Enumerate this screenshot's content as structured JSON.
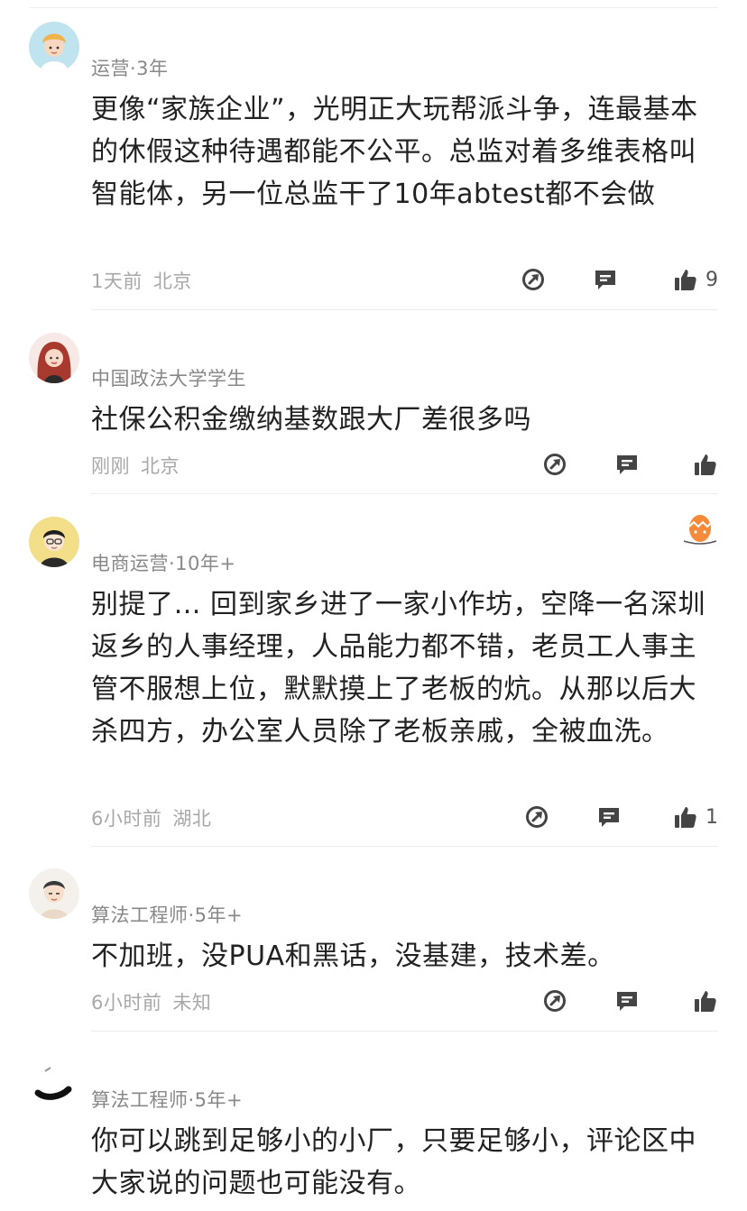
{
  "comments": [
    {
      "meta": "运营·3年",
      "text": "更像“家族企业”，光明正大玩帮派斗争，连最基本的休假这种待遇都能不公平。总监对着多维表格叫智能体，另一位总监干了10年abtest都不会做",
      "time": "1天前",
      "location": "北京",
      "likes": "9"
    },
    {
      "meta": "中国政法大学学生",
      "text": "社保公积金缴纳基数跟大厂差很多吗",
      "time": "刚刚",
      "location": "北京",
      "likes": ""
    },
    {
      "meta": "电商运营·10年+",
      "text": "别提了… 回到家乡进了一家小作坊，空降一名深圳返乡的人事经理，人品能力都不错，老员工人事主管不服想上位，默默摸上了老板的炕。从那以后大杀四方，办公室人员除了老板亲戚，全被血洗。",
      "time": "6小时前",
      "location": "湖北",
      "likes": "1"
    },
    {
      "meta": "算法工程师·5年+",
      "text": "不加班，没PUA和黑话，没基建，技术差。",
      "time": "6小时前",
      "location": "未知",
      "likes": ""
    },
    {
      "meta": "算法工程师·5年+",
      "text": "你可以跳到足够小的小厂，只要足够小，评论区中大家说的问题也可能没有。",
      "time": "",
      "location": "",
      "likes": ""
    }
  ],
  "icons": {
    "share": "share-arrow-icon",
    "reply": "comment-bubble-icon",
    "like": "thumbs-up-icon",
    "badge": "egg-badge-icon"
  },
  "colors": {
    "icon": "#444444",
    "meta": "#888888",
    "footer": "#a8a8a8",
    "text": "#222222"
  }
}
